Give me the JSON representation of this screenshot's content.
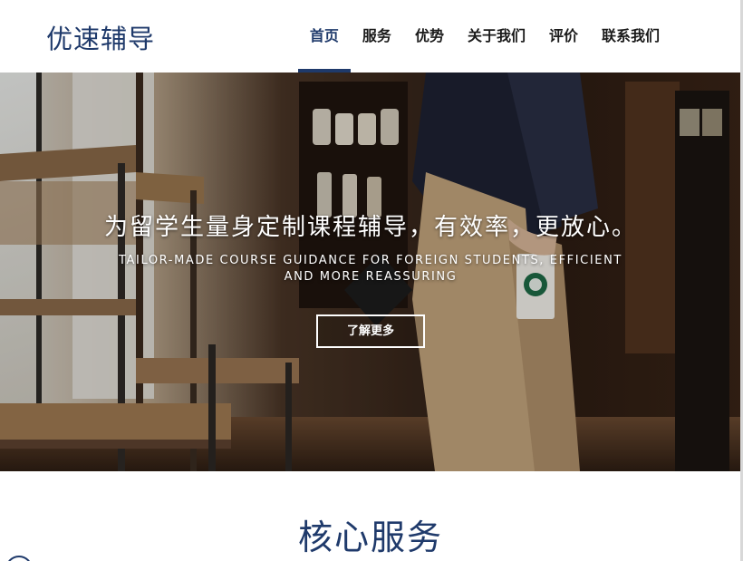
{
  "header": {
    "logo": "优速辅导",
    "nav": [
      {
        "label": "首页",
        "active": true
      },
      {
        "label": "服务",
        "active": false
      },
      {
        "label": "优势",
        "active": false
      },
      {
        "label": "关于我们",
        "active": false
      },
      {
        "label": "评价",
        "active": false
      },
      {
        "label": "联系我们",
        "active": false
      }
    ]
  },
  "hero": {
    "title": "为留学生量身定制课程辅导，有效率，更放心。",
    "subtitle": "TAILOR-MADE COURSE GUIDANCE FOR FOREIGN STUDENTS, EFFICIENT AND MORE REASSURING",
    "button_label": "了解更多"
  },
  "section": {
    "title": "核心服务"
  },
  "colors": {
    "brand": "#1f3a6b",
    "header_bg": "#ffffff",
    "hero_text": "#ffffff"
  }
}
